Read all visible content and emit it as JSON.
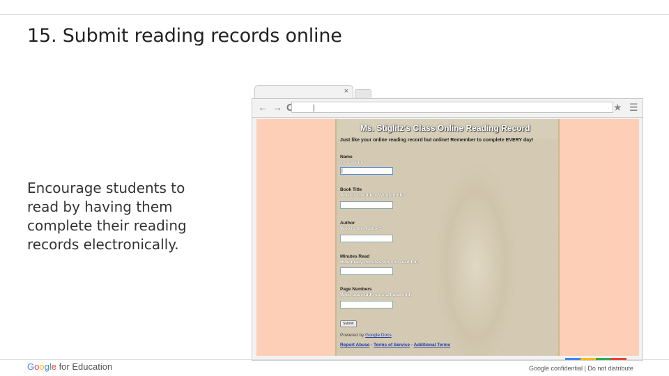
{
  "slide": {
    "title": "15. Submit reading records online",
    "body": "Encourage students to read by having them complete their reading records electronically."
  },
  "browser": {
    "tab_close": "×",
    "nav_back": "←",
    "nav_forward": "→",
    "nav_reload": "C",
    "address_value": "|",
    "star": "★",
    "menu": "☰"
  },
  "form": {
    "title": "Ms. Stiglitz's Class Online Reading Record",
    "description": "Just like your online reading record but online!  Remember to complete EVERY day!",
    "fields": [
      {
        "label": "Name",
        "help": "Your name",
        "value": "|"
      },
      {
        "label": "Book Title",
        "help": "What is the title of your book?",
        "value": ""
      },
      {
        "label": "Author",
        "help": "Who is the Author?",
        "value": ""
      },
      {
        "label": "Minutes Read",
        "help": "How many minutes did you read for?",
        "value": ""
      },
      {
        "label": "Page Numbers",
        "help": "What page did you start and end?",
        "value": ""
      }
    ],
    "submit_label": "Submit",
    "powered_prefix": "Powered by",
    "powered_link": "Google Docs",
    "report_abuse": "Report Abuse",
    "separator": " - ",
    "terms": "Terms of Service",
    "additional_terms": "Additional Terms"
  },
  "footer": {
    "logo_letters": [
      "G",
      "o",
      "o",
      "g",
      "l",
      "e"
    ],
    "logo_suffix": " for Education",
    "confidential": "Google confidential | Do not distribute",
    "brand_colors": [
      "#4285f4",
      "#fbbc05",
      "#34a853",
      "#ea4335"
    ]
  }
}
